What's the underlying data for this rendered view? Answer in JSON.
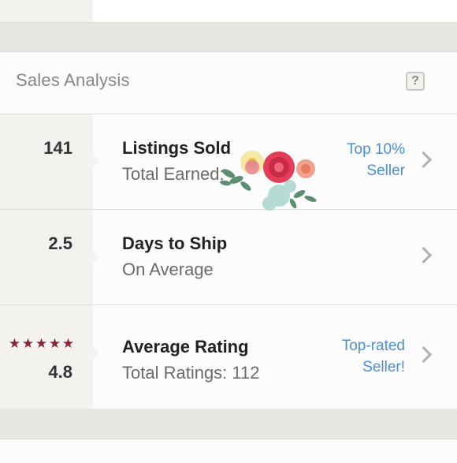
{
  "header": {
    "title": "Sales Analysis",
    "help_label": "?"
  },
  "rows": [
    {
      "stat": "141",
      "title": "Listings Sold",
      "subtitle": "Total Earned:",
      "badge_line1": "Top 10%",
      "badge_line2": "Seller"
    },
    {
      "stat": "2.5",
      "title": "Days to Ship",
      "subtitle": "On Average"
    },
    {
      "stat": "4.8",
      "title": "Average Rating",
      "subtitle": "Total Ratings: 112",
      "badge_line1": "Top-rated",
      "badge_line2": "Seller!",
      "stars": 5
    }
  ],
  "colors": {
    "link": "#4a8fd0",
    "star": "#8b2332"
  }
}
